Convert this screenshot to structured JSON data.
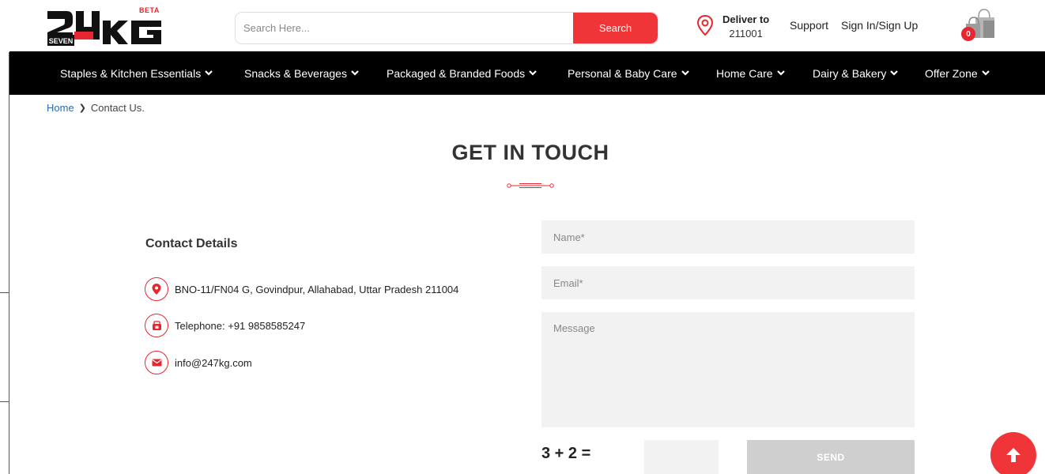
{
  "header": {
    "beta_label": "BETA",
    "search": {
      "placeholder": "Search Here...",
      "button_label": "Search"
    },
    "deliver": {
      "title": "Deliver to",
      "pincode": "211001"
    },
    "support_label": "Support",
    "signin_label": "Sign In/Sign Up",
    "cart_count": "0"
  },
  "nav": {
    "items": [
      {
        "label": "Staples & Kitchen Essentials"
      },
      {
        "label": "Snacks & Beverages"
      },
      {
        "label": "Packaged & Branded Foods"
      },
      {
        "label": "Personal & Baby Care"
      },
      {
        "label": "Home Care"
      },
      {
        "label": "Dairy & Bakery"
      },
      {
        "label": "Offer Zone"
      }
    ]
  },
  "breadcrumb": {
    "home": "Home",
    "current": "Contact Us."
  },
  "page": {
    "title": "GET IN TOUCH"
  },
  "contact": {
    "heading": "Contact Details",
    "address": "BNO-11/FN04 G, Govindpur, Allahabad, Uttar Pradesh 211004",
    "telephone": "Telephone: +91 9858585247",
    "email": "info@247kg.com"
  },
  "form": {
    "name_placeholder": "Name*",
    "email_placeholder": "Email*",
    "message_placeholder": "Message",
    "captcha_question": "3 + 2 =",
    "send_label": "SEND"
  },
  "colors": {
    "accent": "#ef3538",
    "nav_bg": "#000000",
    "link": "#2b6cb0",
    "field_bg": "#f2f2f2"
  },
  "icons": {
    "deliver": "location-pin-icon",
    "cart": "shopping-bags-icon",
    "nav_chevron": "chevron-down-icon",
    "address": "map-marker-icon",
    "telephone": "phone-icon",
    "email": "envelope-icon",
    "scroll_top": "arrow-up-icon"
  }
}
